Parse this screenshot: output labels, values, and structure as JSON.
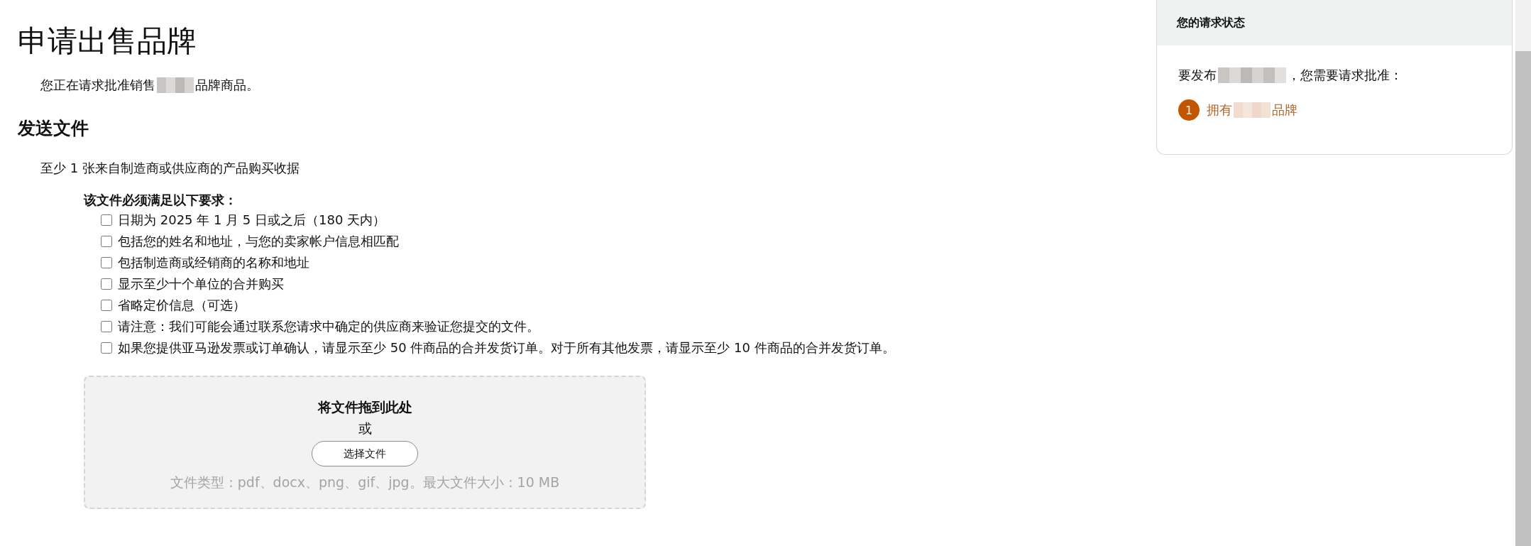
{
  "page_title": "申请出售品牌",
  "intro": {
    "before": "您正在请求批准销售",
    "after": "品牌商品。"
  },
  "section": {
    "heading": "发送文件",
    "document": "至少 1 张来自制造商或供应商的产品购买收据",
    "requirements_heading": "该文件必须满足以下要求：",
    "requirements": [
      {
        "label": "日期为 2025 年 1 月 5 日或之后（180 天内）",
        "checked": false
      },
      {
        "label": "包括您的姓名和地址，与您的卖家帐户信息相匹配",
        "checked": false
      },
      {
        "label": "包括制造商或经销商的名称和地址",
        "checked": false
      },
      {
        "label": "显示至少十个单位的合并购买",
        "checked": false
      },
      {
        "label": "省略定价信息（可选）",
        "checked": false
      },
      {
        "label": "请注意：我们可能会通过联系您请求中确定的供应商来验证您提交的文件。",
        "checked": false
      },
      {
        "label": "如果您提供亚马逊发票或订单确认，请显示至少 50 件商品的合并发货订单。对于所有其他发票，请显示至少 10 件商品的合并发货订单。",
        "checked": false
      }
    ]
  },
  "upload": {
    "title": "将文件拖到此处",
    "or": "或",
    "button": "选择文件",
    "hint": "文件类型：pdf、docx、png、gif、jpg。最大文件大小：10 MB"
  },
  "status_card": {
    "title": "您的请求状态",
    "before": "要发布",
    "after": "，您需要请求批准：",
    "steps": [
      {
        "number": "1",
        "before": "拥有",
        "after": "品牌"
      }
    ]
  }
}
